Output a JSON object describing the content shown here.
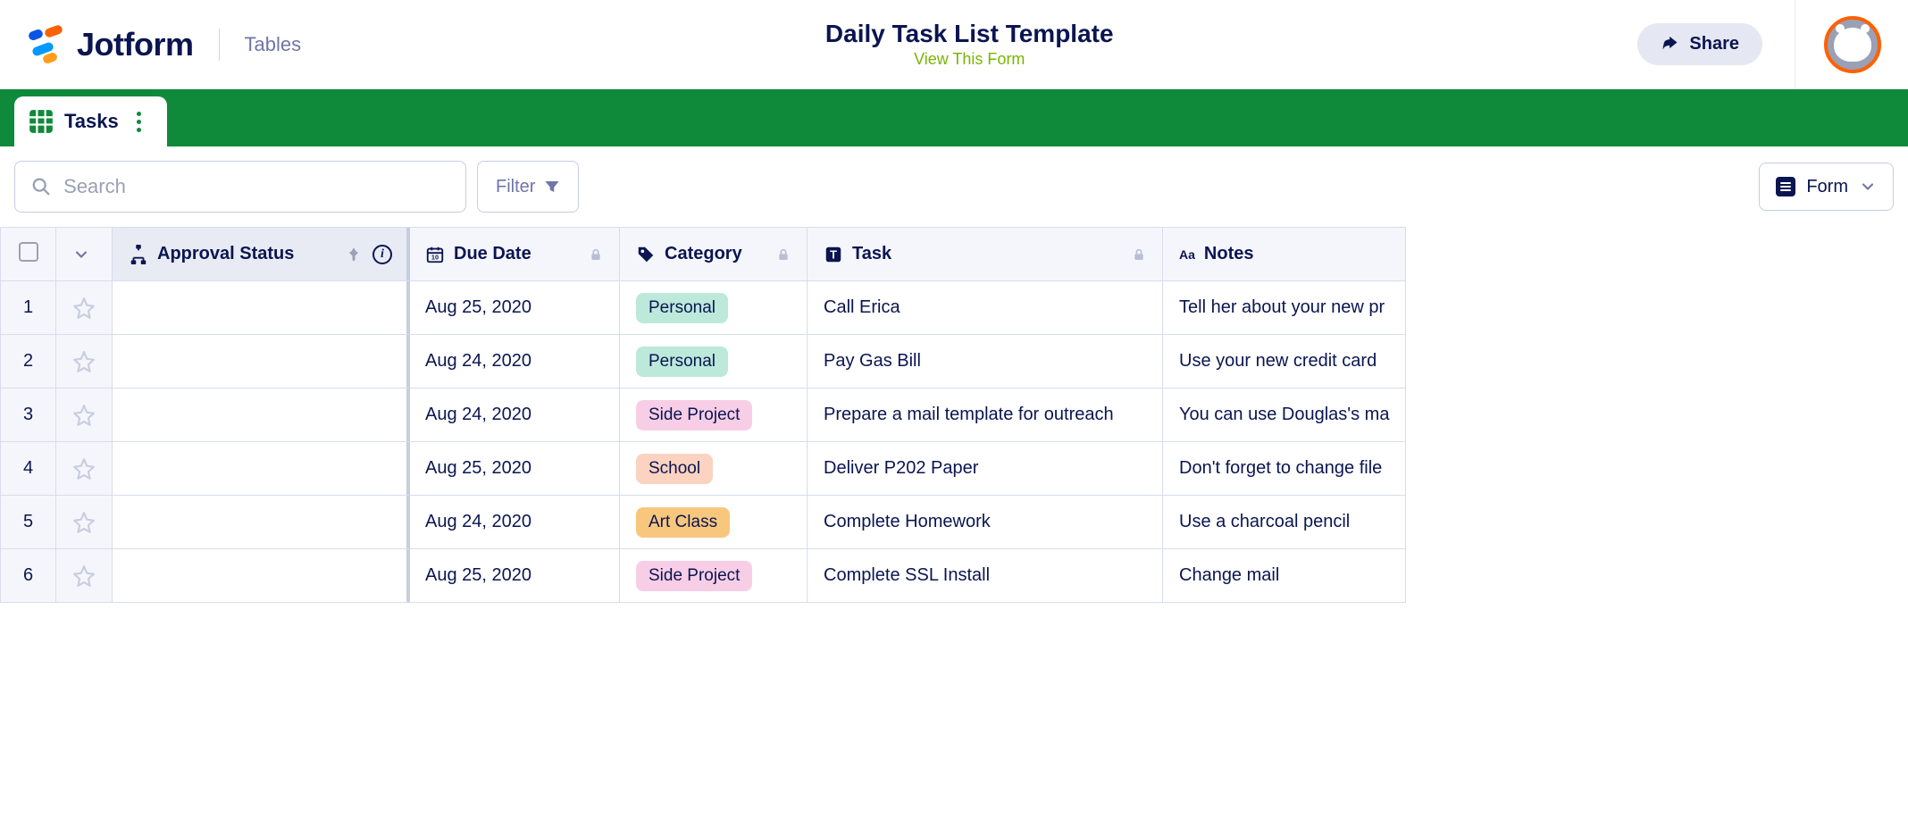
{
  "brand": {
    "name": "Jotform",
    "section": "Tables"
  },
  "page": {
    "title": "Daily Task List Template",
    "view_link": "View This Form"
  },
  "actions": {
    "share": "Share",
    "filter": "Filter",
    "form_view": "Form"
  },
  "search": {
    "placeholder": "Search"
  },
  "tab": {
    "label": "Tasks"
  },
  "columns": {
    "approval": "Approval Status",
    "due": "Due Date",
    "category": "Category",
    "task": "Task",
    "notes": "Notes"
  },
  "category_colors": {
    "Personal": "#bce9da",
    "Side Project": "#f7cee6",
    "School": "#fbd3c0",
    "Art Class": "#f8c77e"
  },
  "rows": [
    {
      "num": "1",
      "approval": "",
      "due": "Aug 25, 2020",
      "category": "Personal",
      "task": "Call Erica",
      "notes": "Tell her about your new pr"
    },
    {
      "num": "2",
      "approval": "",
      "due": "Aug 24, 2020",
      "category": "Personal",
      "task": "Pay Gas Bill",
      "notes": "Use your new credit card"
    },
    {
      "num": "3",
      "approval": "",
      "due": "Aug 24, 2020",
      "category": "Side Project",
      "task": "Prepare a mail template for outreach",
      "notes": "You can use Douglas's ma"
    },
    {
      "num": "4",
      "approval": "",
      "due": "Aug 25, 2020",
      "category": "School",
      "task": "Deliver P202 Paper",
      "notes": "Don't forget to change file"
    },
    {
      "num": "5",
      "approval": "",
      "due": "Aug 24, 2020",
      "category": "Art Class",
      "task": "Complete Homework",
      "notes": "Use a charcoal pencil"
    },
    {
      "num": "6",
      "approval": "",
      "due": "Aug 25, 2020",
      "category": "Side Project",
      "task": "Complete SSL Install",
      "notes": "Change mail"
    }
  ]
}
